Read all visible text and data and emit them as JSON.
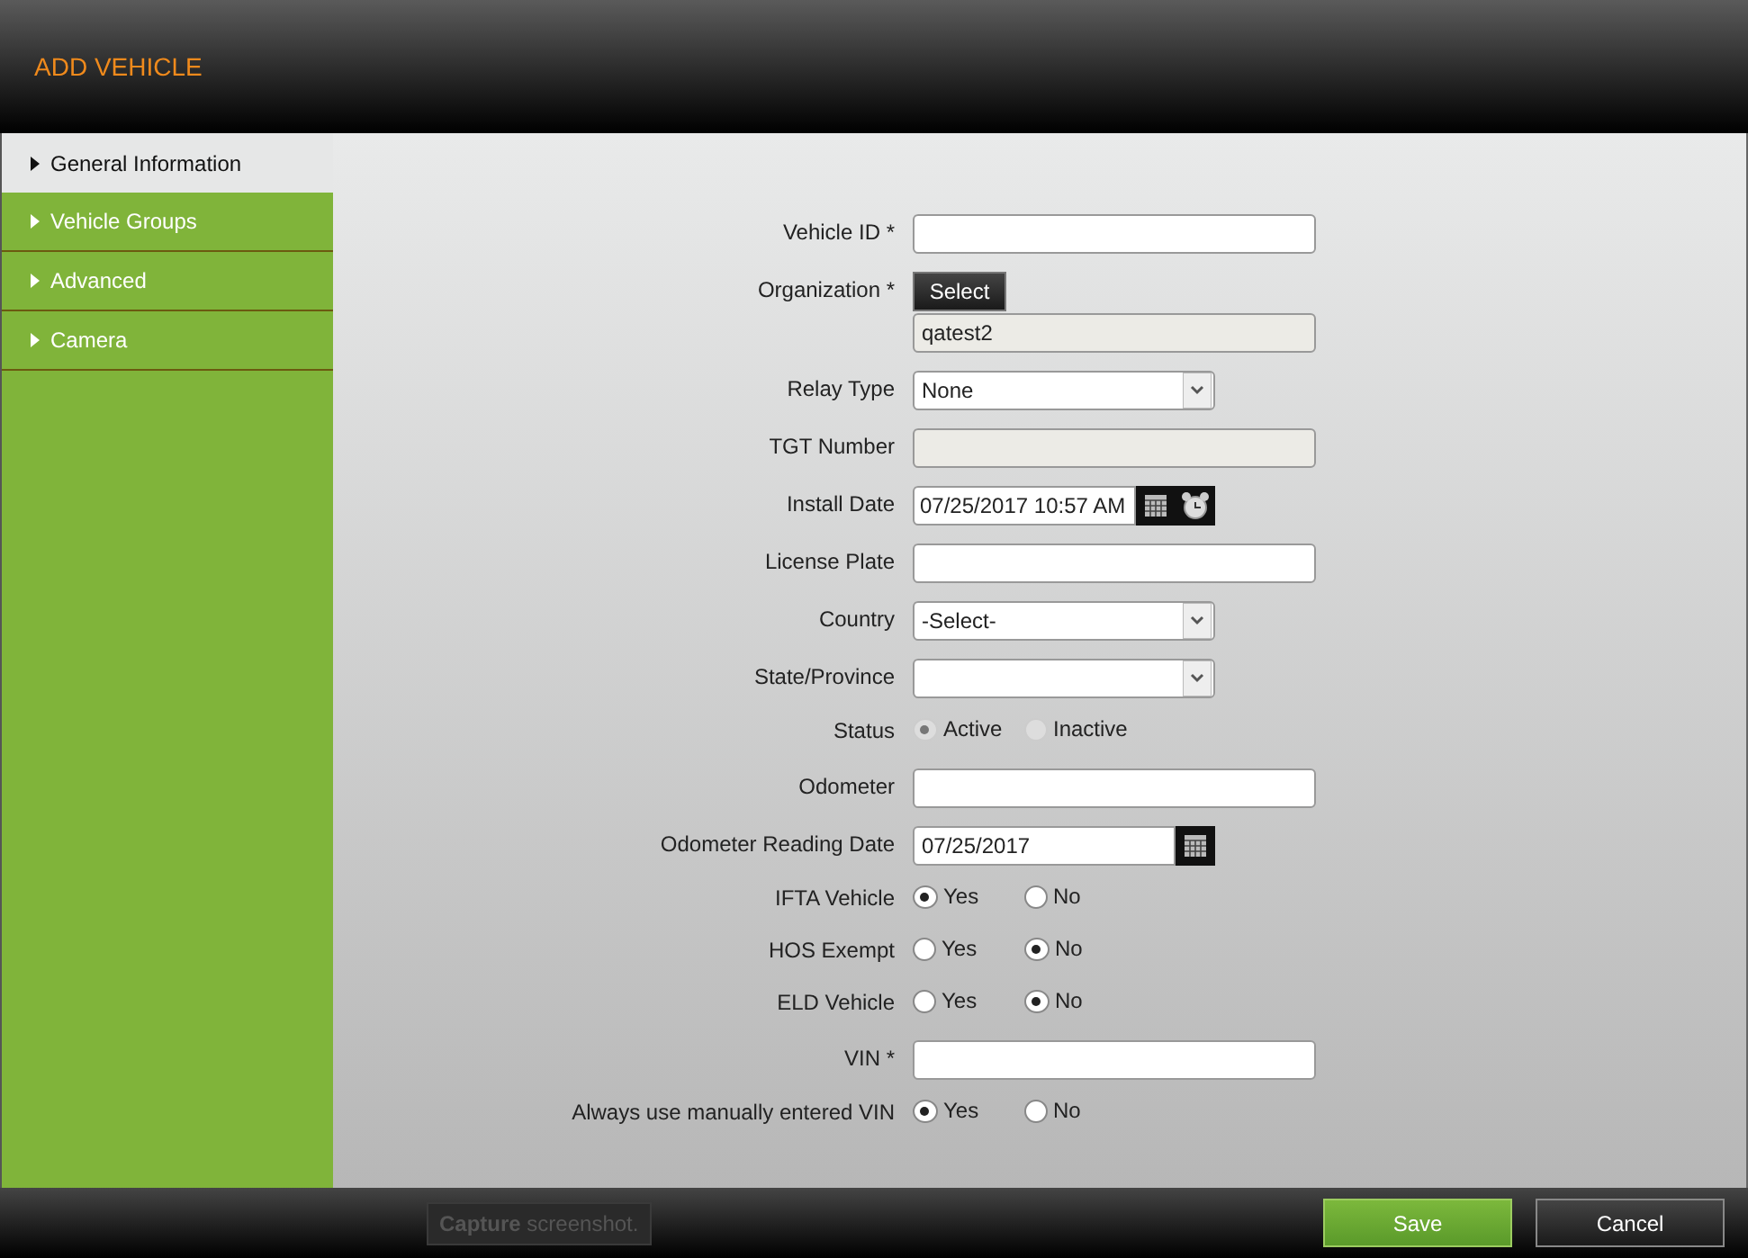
{
  "window": {
    "title": "ADD VEHICLE"
  },
  "sidebar": {
    "items": [
      {
        "label": "General Information",
        "selected": true
      },
      {
        "label": "Vehicle Groups",
        "selected": false
      },
      {
        "label": "Advanced",
        "selected": false
      },
      {
        "label": "Camera",
        "selected": false
      }
    ]
  },
  "form": {
    "fields": [
      {
        "kind": "text",
        "label": "Vehicle ID *",
        "disabled": false
      },
      {
        "kind": "picker",
        "label": "Organization *",
        "button": "Select",
        "value": "qatest2"
      },
      {
        "kind": "select",
        "label": "Relay Type",
        "value": "None"
      },
      {
        "kind": "text",
        "label": "TGT Number",
        "disabled": true
      },
      {
        "kind": "datetime",
        "label": "Install Date",
        "value": "07/25/2017 10:57 AM"
      },
      {
        "kind": "text",
        "label": "License Plate",
        "disabled": false
      },
      {
        "kind": "select",
        "label": "Country",
        "value": "-Select-"
      },
      {
        "kind": "select",
        "label": "State/Province"
      },
      {
        "kind": "radio",
        "label": "Status",
        "disabled": true,
        "options": [
          {
            "label": "Active",
            "selected": true
          },
          {
            "label": "Inactive",
            "selected": false
          }
        ]
      },
      {
        "kind": "text",
        "label": "Odometer",
        "disabled": false
      },
      {
        "kind": "date",
        "label": "Odometer Reading Date",
        "value": "07/25/2017"
      },
      {
        "kind": "radio",
        "label": "IFTA Vehicle",
        "disabled": false,
        "options": [
          {
            "label": "Yes",
            "selected": true
          },
          {
            "label": "No",
            "selected": false
          }
        ]
      },
      {
        "kind": "radio",
        "label": "HOS Exempt",
        "disabled": false,
        "options": [
          {
            "label": "Yes",
            "selected": false
          },
          {
            "label": "No",
            "selected": true
          }
        ]
      },
      {
        "kind": "radio",
        "label": "ELD Vehicle",
        "disabled": false,
        "options": [
          {
            "label": "Yes",
            "selected": false
          },
          {
            "label": "No",
            "selected": true
          }
        ]
      },
      {
        "kind": "text",
        "label": "VIN *",
        "disabled": false
      },
      {
        "kind": "radio",
        "label": "Always use manually entered VIN",
        "disabled": false,
        "options": [
          {
            "label": "Yes",
            "selected": true
          },
          {
            "label": "No",
            "selected": false
          }
        ]
      }
    ]
  },
  "footer": {
    "capture_button": "**Capture** screenshot.",
    "buttons": [
      {
        "label": "Save",
        "kind": "primary"
      },
      {
        "label": "Cancel",
        "kind": "secondary"
      }
    ]
  }
}
